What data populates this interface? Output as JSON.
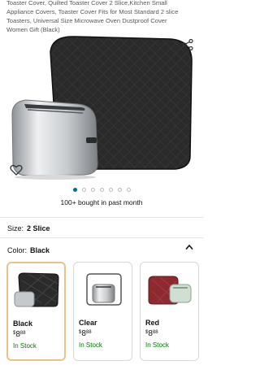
{
  "product": {
    "title": "Toaster Cover, Quilted Toaster Cover 2 Slice,Kitchen Small Appliance Covers, Toaster Cover Fits for Most Standard 2 slice Toasters, Universal Size Microwave Oven Dustproof Cover Women Gift (Black)",
    "bought": "100+ bought in past month",
    "carousel_dots": 7,
    "active_dot": 0
  },
  "size": {
    "label": "Size:",
    "value": "2 Slice"
  },
  "color": {
    "label": "Color:",
    "value": "Black"
  },
  "variants": [
    {
      "name": "Black",
      "price_symbol": "$",
      "price_whole": "8",
      "price_fraction": "88",
      "stock": "In Stock",
      "selected": true
    },
    {
      "name": "Clear",
      "price_symbol": "$",
      "price_whole": "8",
      "price_fraction": "88",
      "stock": "In Stock",
      "selected": false
    },
    {
      "name": "Red",
      "price_symbol": "$",
      "price_whole": "8",
      "price_fraction": "88",
      "stock": "In Stock",
      "selected": false
    }
  ],
  "icons": {
    "share": "share-icon",
    "wishlist": "heart-icon",
    "collapse": "chevron-up-icon"
  },
  "colors": {
    "accent_teal": "#007185",
    "stock_green": "#007600",
    "selected_border": "#e8c48a"
  }
}
